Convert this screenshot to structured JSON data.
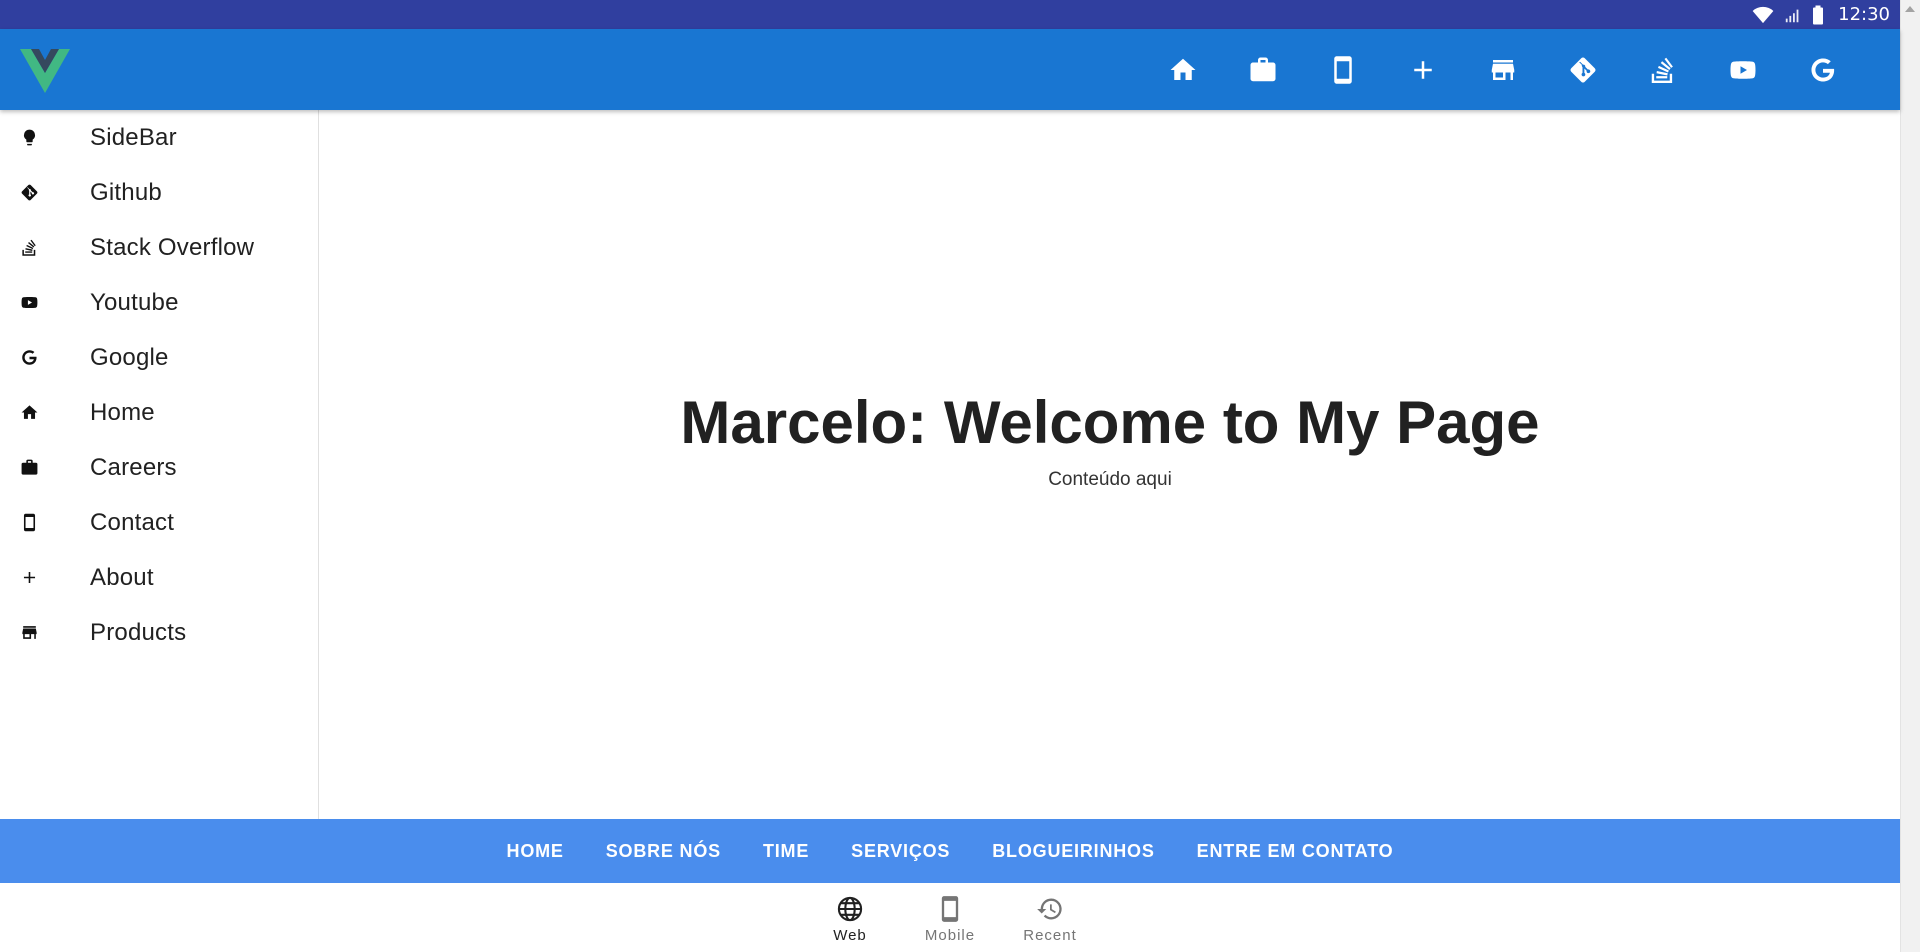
{
  "status_bar": {
    "time": "12:30"
  },
  "app_bar": {
    "logo": "vue-logo",
    "actions": [
      {
        "icon": "home-icon"
      },
      {
        "icon": "briefcase-icon"
      },
      {
        "icon": "cellphone-icon"
      },
      {
        "icon": "plus-icon"
      },
      {
        "icon": "store-icon"
      },
      {
        "icon": "git-icon"
      },
      {
        "icon": "stack-overflow-icon"
      },
      {
        "icon": "youtube-icon"
      },
      {
        "icon": "google-icon"
      }
    ]
  },
  "sidebar": {
    "items": [
      {
        "label": "SideBar",
        "icon": "lightbulb-icon"
      },
      {
        "label": "Github",
        "icon": "git-icon"
      },
      {
        "label": "Stack Overflow",
        "icon": "stack-overflow-icon"
      },
      {
        "label": "Youtube",
        "icon": "youtube-icon"
      },
      {
        "label": "Google",
        "icon": "google-icon"
      },
      {
        "label": "Home",
        "icon": "home-icon"
      },
      {
        "label": "Careers",
        "icon": "briefcase-icon"
      },
      {
        "label": "Contact",
        "icon": "cellphone-icon"
      },
      {
        "label": "About",
        "icon": "plus-icon"
      },
      {
        "label": "Products",
        "icon": "store-icon"
      }
    ]
  },
  "main": {
    "title": "Marcelo: Welcome to My Page",
    "subtitle": "Conteúdo aqui"
  },
  "footer": {
    "links": [
      "HOME",
      "SOBRE NÓS",
      "TIME",
      "SERVIÇOS",
      "BLOGUEIRINHOS",
      "ENTRE EM CONTATO"
    ]
  },
  "bottom_nav": {
    "items": [
      {
        "label": "Web",
        "icon": "globe-icon",
        "active": true
      },
      {
        "label": "Mobile",
        "icon": "cellphone-icon",
        "active": false
      },
      {
        "label": "Recent",
        "icon": "history-icon",
        "active": false
      }
    ]
  },
  "colors": {
    "status_bar": "#303f9f",
    "app_bar": "#1976d2",
    "footer": "#4a8ded",
    "logo_green": "#41b883",
    "logo_dark": "#35495e"
  }
}
